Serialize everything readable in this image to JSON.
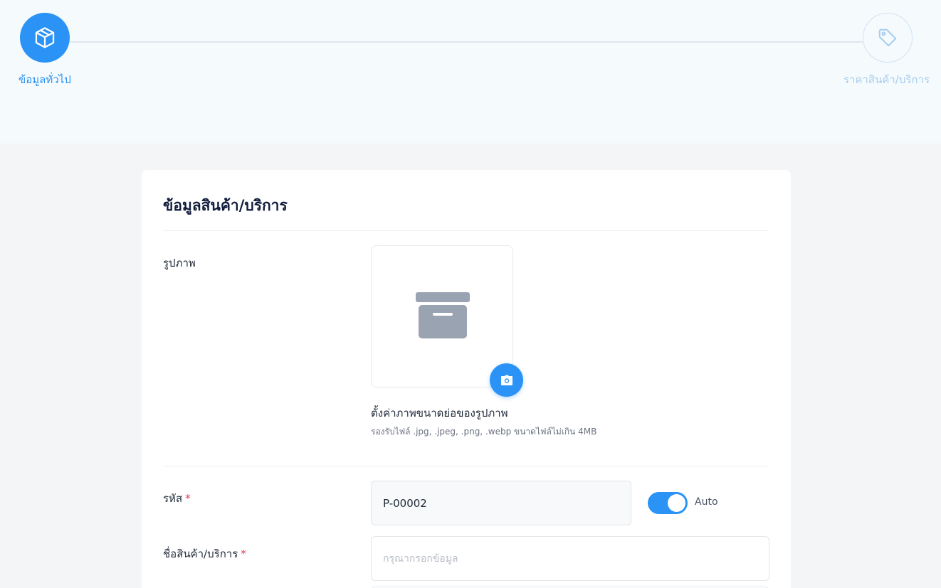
{
  "stepper": {
    "steps": [
      {
        "label": "ข้อมูลทั่วไป",
        "icon": "cube-icon",
        "state": "active"
      },
      {
        "label": "ราคาสินค้า/บริการ",
        "icon": "tag-icon",
        "state": "inactive"
      }
    ]
  },
  "card": {
    "title": "ข้อมูลสินค้า/บริการ",
    "image_section": {
      "label": "รูปภาพ",
      "placeholder_icon": "archive-icon",
      "upload_icon": "camera-icon",
      "thumb_title": "ตั้งค่าภาพขนาดย่อของรูปภาพ",
      "hint": "รองรับไฟล์ .jpg, .jpeg, .png, .webp ขนาดไฟล์ไม่เกิน 4MB"
    },
    "code_field": {
      "label": "รหัส",
      "required_mark": "*",
      "value": "P-00002",
      "auto_toggle_on": true,
      "auto_label": "Auto"
    },
    "name_field": {
      "label": "ชื่อสินค้า/บริการ",
      "required_mark": "*",
      "placeholder": "กรุณากรอกข้อมูล"
    }
  },
  "colors": {
    "accent": "#2b93f5",
    "required": "#e53950",
    "title": "#111c3d"
  }
}
